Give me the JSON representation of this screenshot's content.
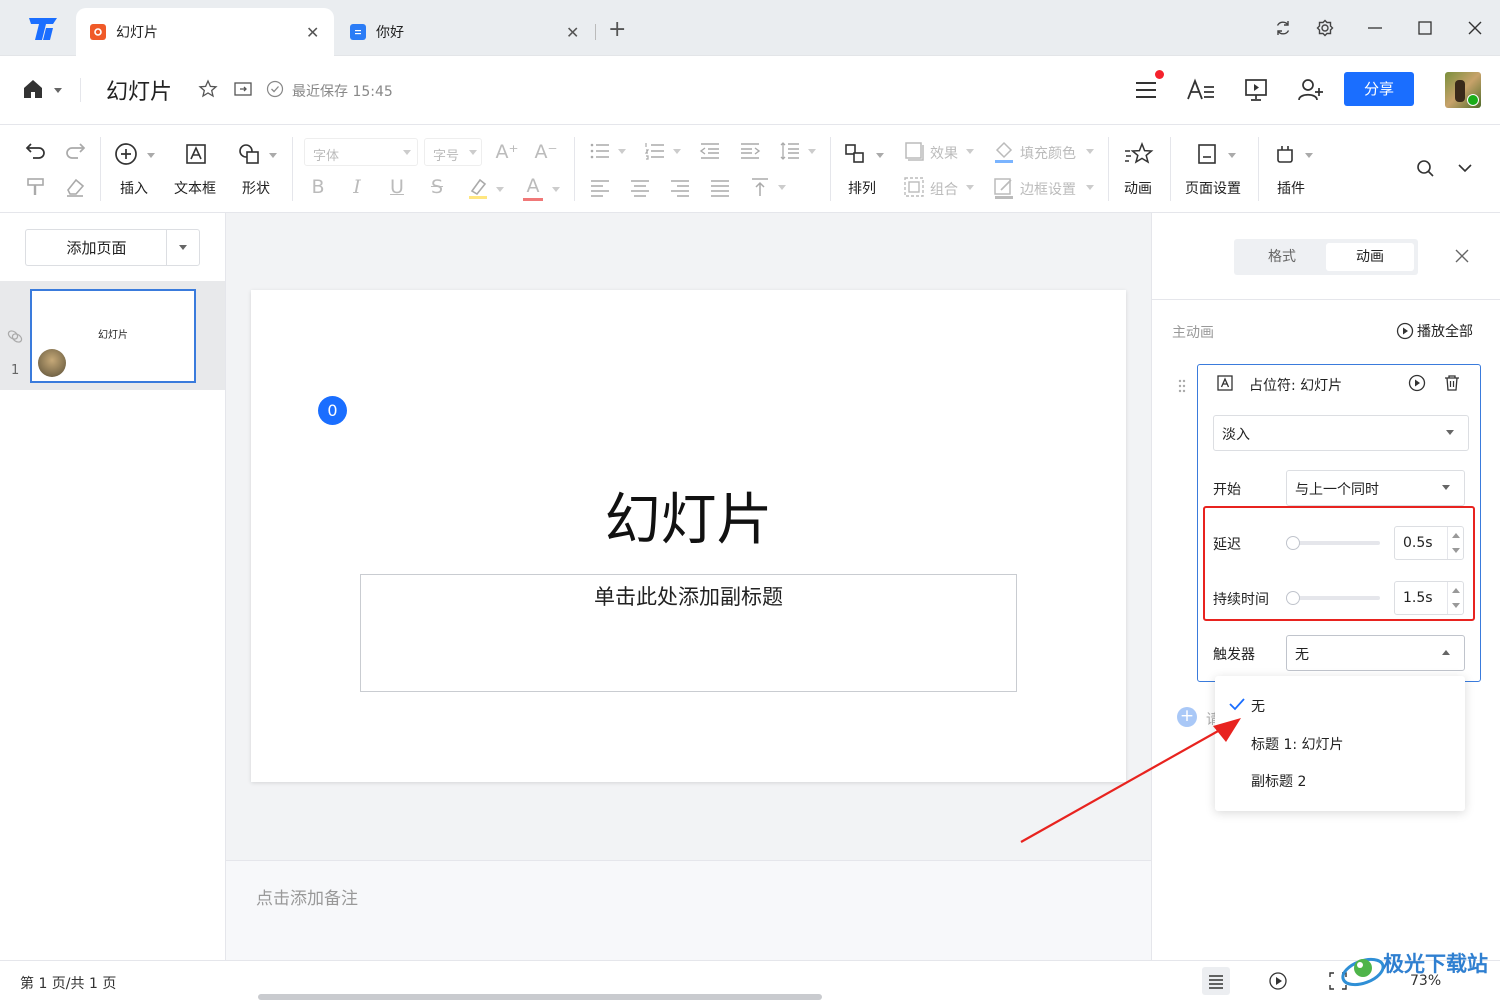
{
  "tabs": [
    {
      "label": "幻灯片",
      "active": true
    },
    {
      "label": "你好",
      "active": false
    }
  ],
  "header": {
    "doc_title": "幻灯片",
    "save_status": "最近保存 15:45",
    "share_label": "分享"
  },
  "toolbar": {
    "insert": "插入",
    "textbox": "文本框",
    "shape": "形状",
    "font_placeholder": "字体",
    "size_placeholder": "字号",
    "bold": "B",
    "italic": "I",
    "underline": "U",
    "strike": "S",
    "font_color": "A",
    "grow": "A⁺",
    "shrink": "A⁻",
    "arrange": "排列",
    "effect": "效果",
    "group": "组合",
    "fill_color": "填充颜色",
    "border_setting": "边框设置",
    "animation": "动画",
    "page_setup": "页面设置",
    "plugin": "插件"
  },
  "left_panel": {
    "add_page": "添加页面",
    "slide_number": "1",
    "thumb_title": "幻灯片"
  },
  "slide": {
    "anim_badge": "0",
    "title": "幻灯片",
    "subtitle_placeholder": "单击此处添加副标题"
  },
  "notes_placeholder": "点击添加备注",
  "right_panel": {
    "tab_format": "格式",
    "tab_animation": "动画",
    "main_animation": "主动画",
    "play_all": "播放全部",
    "item_title": "占位符: 幻灯片",
    "effect_value": "淡入",
    "start_label": "开始",
    "start_value": "与上一个同时",
    "delay_label": "延迟",
    "delay_value": "0.5s",
    "delay_level": 0,
    "duration_label": "持续时间",
    "duration_value": "1.5s",
    "duration_level": 0,
    "trigger_label": "触发器",
    "trigger_value": "无",
    "add_animation_partial": "请",
    "trigger_options": [
      {
        "label": "无",
        "selected": true
      },
      {
        "label": "标题 1: 幻灯片",
        "selected": false
      },
      {
        "label": "副标题 2",
        "selected": false
      }
    ]
  },
  "status": {
    "page_info": "第 1 页/共 1 页",
    "zoom": "73%"
  },
  "watermark": "极光下载站",
  "colors": {
    "accent": "#1a6eff",
    "highlight_border": "#e8231f",
    "arrow": "#e8231f",
    "selection": "#3a7bdc"
  }
}
